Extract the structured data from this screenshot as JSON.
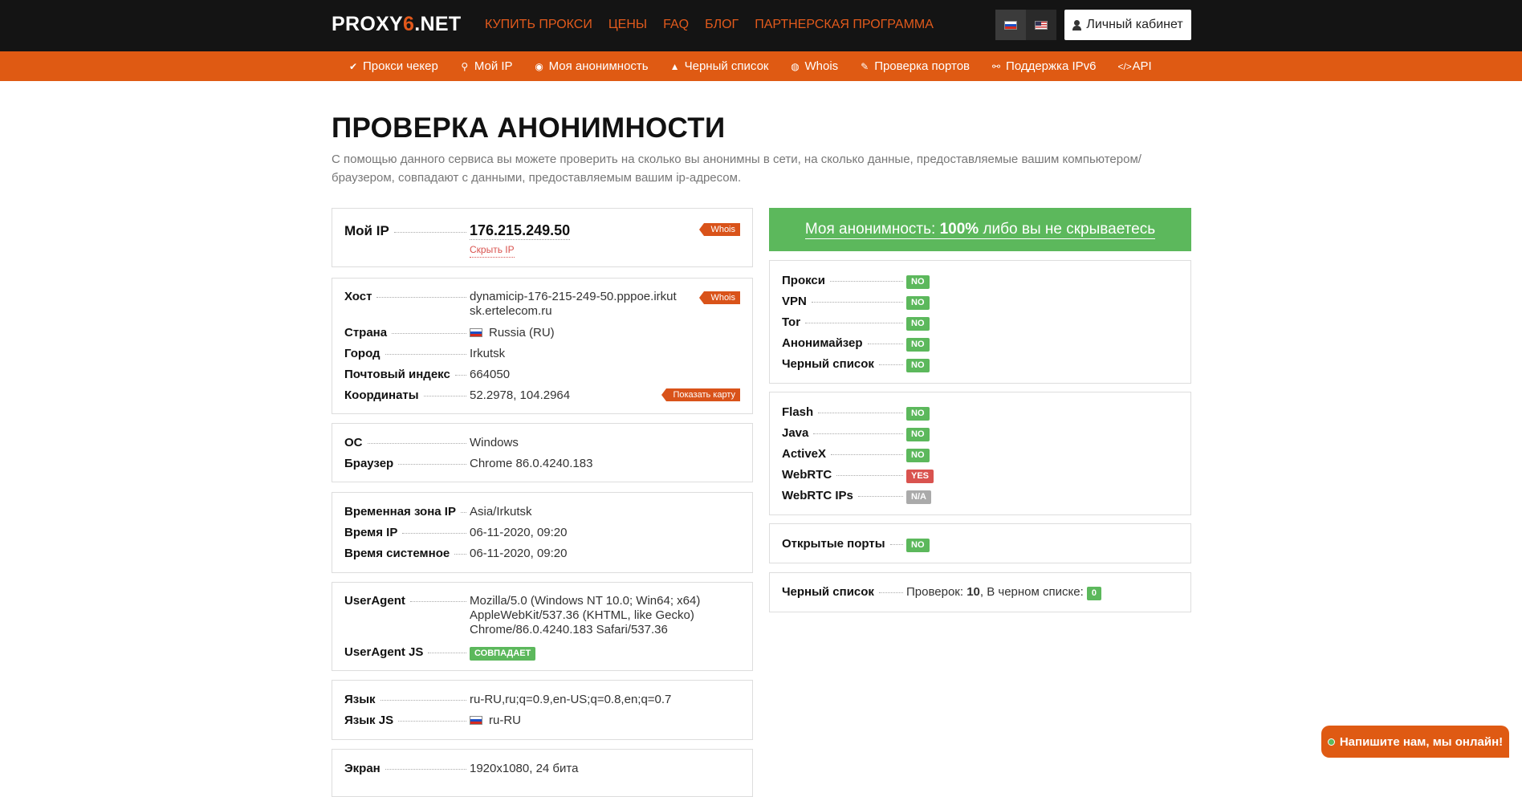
{
  "header": {
    "logo_pre": "PROXY",
    "logo_six": "6",
    "logo_post": ".NET",
    "nav": [
      "КУПИТЬ ПРОКСИ",
      "ЦЕНЫ",
      "FAQ",
      "БЛОГ",
      "ПАРТНЕРСКАЯ ПРОГРАММА"
    ],
    "cabinet": "Личный кабинет"
  },
  "subnav": [
    {
      "icon": "✔",
      "label": "Прокси чекер"
    },
    {
      "icon": "⚲",
      "label": "Мой IP"
    },
    {
      "icon": "◉",
      "label": "Моя анонимность"
    },
    {
      "icon": "▲",
      "label": "Черный список"
    },
    {
      "icon": "◍",
      "label": "Whois"
    },
    {
      "icon": "✎",
      "label": "Проверка портов"
    },
    {
      "icon": "⚯",
      "label": "Поддержка IPv6"
    },
    {
      "icon": "</>",
      "label": "API"
    }
  ],
  "page": {
    "title": "ПРОВЕРКА АНОНИМНОСТИ",
    "description": "С помощью данного сервиса вы можете проверить на сколько вы анонимны в сети, на сколько данные, предоставляемые вашим компьютером/браузером, совпадают с данными, предоставляемым вашим ip-адресом."
  },
  "ip_card": {
    "label": "Мой IP",
    "ip": "176.215.249.50",
    "hide": "Скрыть IP",
    "whois": "Whois"
  },
  "host_card": {
    "host_label": "Хост",
    "host_value": "dynamicip-176-215-249-50.pppoe.irkutsk.ertelecom.ru",
    "whois": "Whois",
    "country_label": "Страна",
    "country_value": "Russia (RU)",
    "city_label": "Город",
    "city_value": "Irkutsk",
    "zip_label": "Почтовый индекс",
    "zip_value": "664050",
    "coords_label": "Координаты",
    "coords_value": "52.2978, 104.2964",
    "map": "Показать карту"
  },
  "os_card": {
    "os_label": "ОС",
    "os_value": "Windows",
    "browser_label": "Браузер",
    "browser_value": "Chrome 86.0.4240.183"
  },
  "time_card": {
    "tz_label": "Временная зона IP",
    "tz_value": "Asia/Irkutsk",
    "iptime_label": "Время IP",
    "iptime_value": "06-11-2020, 09:20",
    "systime_label": "Время системное",
    "systime_value": "06-11-2020, 09:20"
  },
  "ua_card": {
    "ua_label": "UserAgent",
    "ua_value": "Mozilla/5.0 (Windows NT 10.0; Win64; x64) AppleWebKit/537.36 (KHTML, like Gecko) Chrome/86.0.4240.183 Safari/537.36",
    "uajs_label": "UserAgent JS",
    "uajs_value": "СОВПАДАЕТ"
  },
  "lang_card": {
    "lang_label": "Язык",
    "lang_value": "ru-RU,ru;q=0.9,en-US;q=0.8,en;q=0.7",
    "langjs_label": "Язык JS",
    "langjs_value": "ru-RU"
  },
  "screen_card": {
    "screen_label": "Экран",
    "screen_value": "1920x1080, 24 бита"
  },
  "anonymity": {
    "prefix": "Моя анонимность: ",
    "percent": "100%",
    "suffix": " либо вы не скрываетесь"
  },
  "checks1": [
    {
      "label": "Прокси",
      "value": "NO"
    },
    {
      "label": "VPN",
      "value": "NO"
    },
    {
      "label": "Tor",
      "value": "NO"
    },
    {
      "label": "Анонимайзер",
      "value": "NO"
    },
    {
      "label": "Черный список",
      "value": "NO"
    }
  ],
  "checks2": [
    {
      "label": "Flash",
      "value": "NO"
    },
    {
      "label": "Java",
      "value": "NO"
    },
    {
      "label": "ActiveX",
      "value": "NO"
    },
    {
      "label": "WebRTC",
      "value": "YES"
    },
    {
      "label": "WebRTC IPs",
      "value": "N/A"
    }
  ],
  "ports": {
    "label": "Открытые порты",
    "value": "NO"
  },
  "blacklist": {
    "label": "Черный список",
    "checks_text": "Проверок: ",
    "checks_count": "10",
    "in_list_text": ", В черном списке: ",
    "in_list_count": "0"
  },
  "chat": {
    "label": "Напишите нам, мы онлайн!"
  },
  "colors": {
    "accent": "#df5a13",
    "green": "#5cb85c",
    "red": "#d9534f",
    "dark": "#141414"
  }
}
